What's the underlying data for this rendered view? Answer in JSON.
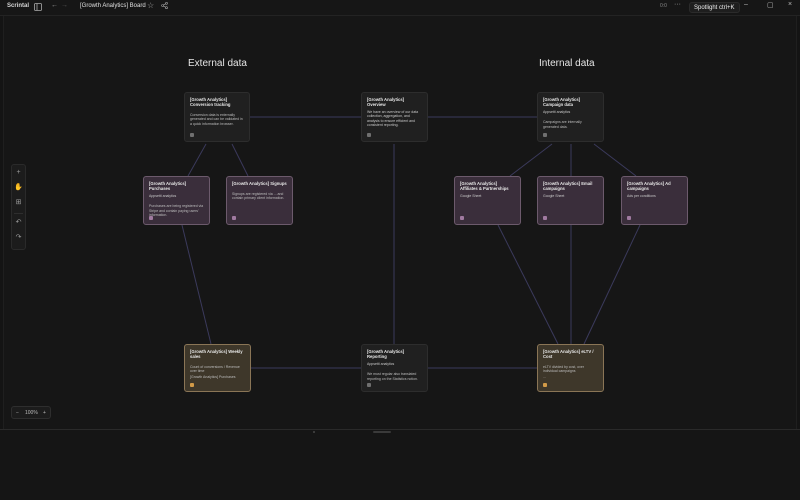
{
  "titlebar": {
    "app_name": "Scrintal",
    "board_title": "[Growth Analytics] Board",
    "sync": "0:0",
    "spotlight": "Spotlight ctrl+K"
  },
  "sections": {
    "external": "External data",
    "internal": "Internal data"
  },
  "cards": {
    "conversion": {
      "title": "[Growth Analytics] Conversion tracking",
      "sub": "",
      "desc": "Conversion data is externally generated and can be validated in a quick information browser."
    },
    "overview": {
      "title": "[Growth Analytics] Overview",
      "sub": "",
      "desc": "We have an overview of our data collection, aggregation, and analysis to ensure efficient and consistent reporting."
    },
    "campaign": {
      "title": "[Growth Analytics] Campaign data",
      "sub": "Appsetti analytics",
      "desc": "Campaigns are internally generated data."
    },
    "purchases": {
      "title": "[Growth Analytics] Purchases",
      "sub": "Appsetti analytics",
      "desc": "Purchases are being registered via Stripe and contain paying users' information."
    },
    "signups": {
      "title": "[Growth Analytics] Signups",
      "sub": "",
      "desc": "Signups are registered via ... and contain primary client information."
    },
    "affiliates": {
      "title": "[Growth Analytics] Affiliates & Partnerships",
      "sub": "Google Sheet",
      "desc": ""
    },
    "email": {
      "title": "[Growth Analytics] Email campaigns",
      "sub": "Google Sheet",
      "desc": ""
    },
    "ad": {
      "title": "[Growth Analytics] Ad campaigns",
      "sub": "Ads per conditions",
      "desc": ""
    },
    "weekly": {
      "title": "[Growth Analytics] Weekly sales",
      "sub": "",
      "desc": "Count of conversions / Revenue over time",
      "desc2": "[Growth Analytics] Purchases"
    },
    "reporting": {
      "title": "[Growth Analytics] Reporting",
      "sub": "Appsetti analytics",
      "desc": "We must regular also translated reporting on the Statistics notion."
    },
    "eltv": {
      "title": "[Growth Analytics] eLTV / Cost",
      "sub": "",
      "desc": "eLTV divided by cost, over individual campaigns",
      "desc2": "..."
    }
  },
  "zoom": {
    "minus": "−",
    "value": "100%",
    "plus": "+"
  },
  "colors": {
    "purple_card": "#3a2e3b",
    "gold_card": "#3e372a",
    "edge": "#3b3a5c"
  }
}
